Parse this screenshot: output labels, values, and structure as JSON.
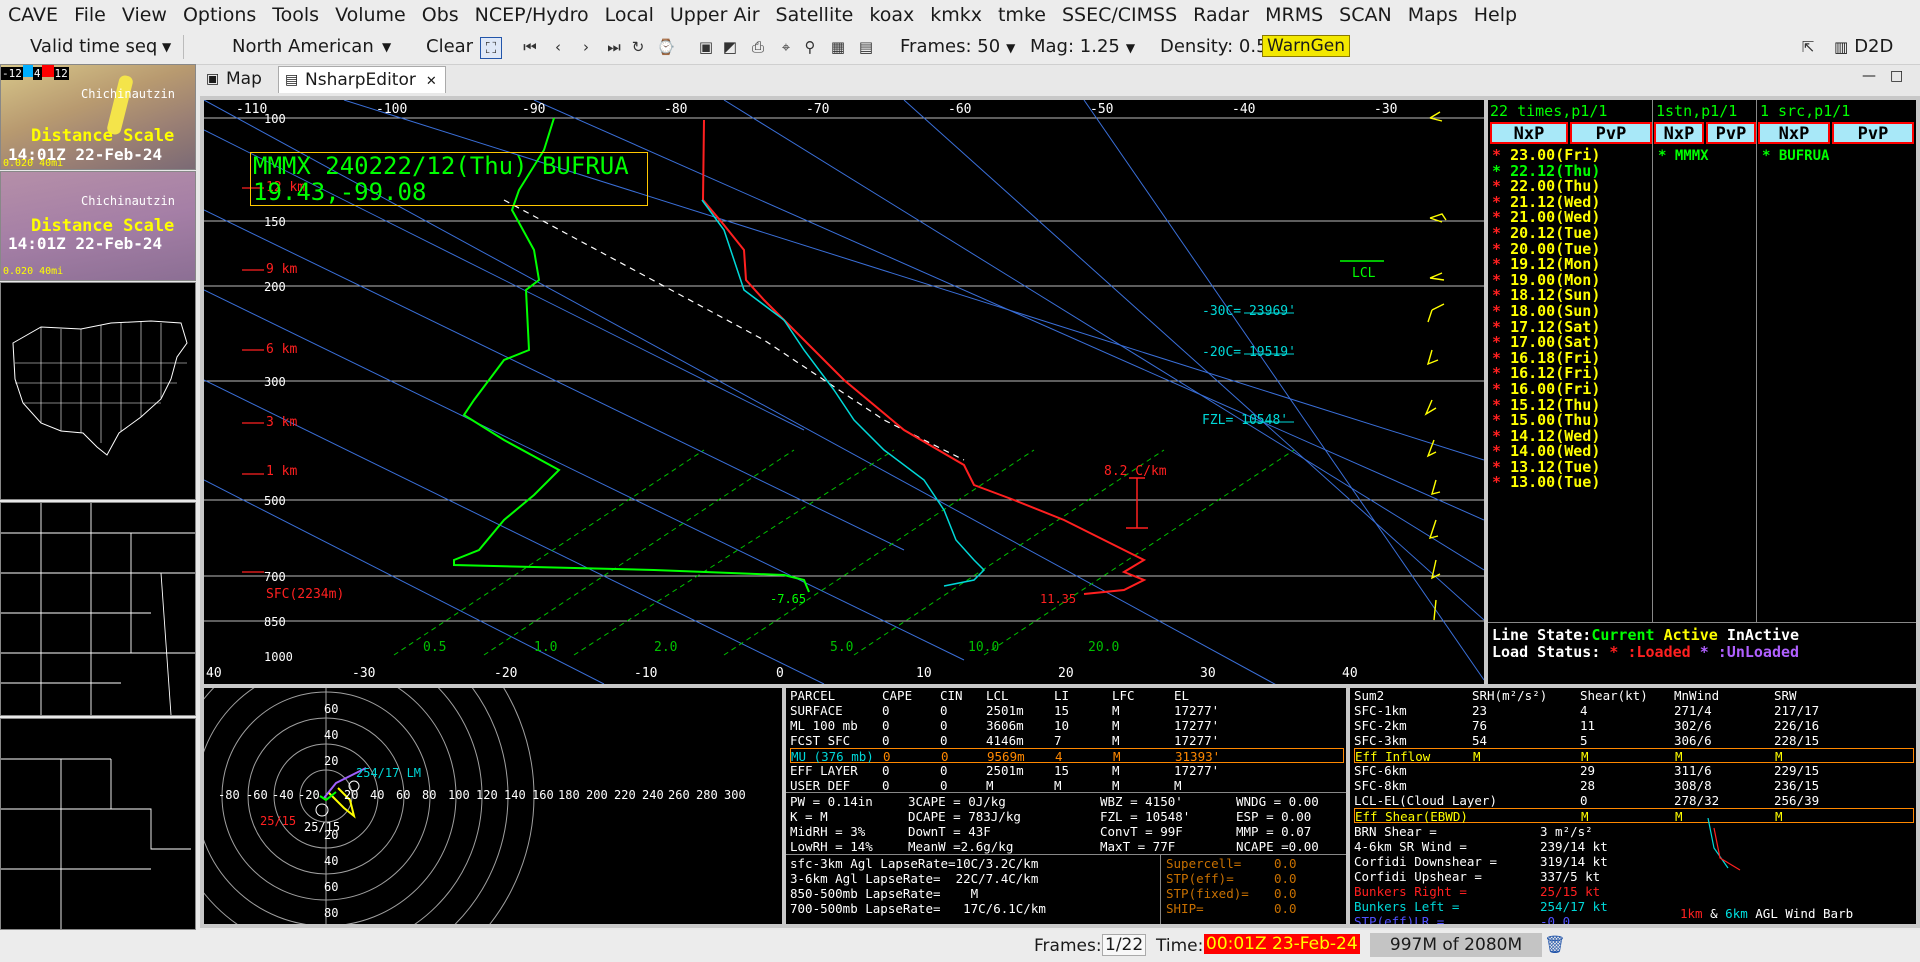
{
  "menu": [
    "CAVE",
    "File",
    "View",
    "Options",
    "Tools",
    "Volume",
    "Obs",
    "NCEP/Hydro",
    "Local",
    "Upper Air",
    "Satellite",
    "koax",
    "kmkx",
    "tmke",
    "SSEC/CIMSS",
    "Radar",
    "MRMS",
    "SCAN",
    "Maps",
    "Help"
  ],
  "toolbar": {
    "time_mode": "Valid time seq",
    "projection": "North American",
    "clear": "Clear",
    "frames": "Frames: 50",
    "mag": "Mag: 1.25",
    "density": "Density: 0.5",
    "warngen": "WarnGen",
    "d2d": "D2D"
  },
  "left_panels": {
    "colorbar": [
      "-12",
      "4",
      "12"
    ],
    "place": "Chichinautzin",
    "distance_scale": "Distance Scale",
    "time": "14:01Z 22-Feb-24",
    "scale_label": "0.020 40mi"
  },
  "tabs": {
    "map": "Map",
    "nsharp": "NsharpEditor"
  },
  "skewt": {
    "station_title": "MMMX 240222/12(Thu) BUFRUA",
    "latlon": "19.43,-99.08",
    "top_temps": [
      "-110",
      "-100",
      "-90",
      "-80",
      "-70",
      "-60",
      "-50",
      "-40",
      "-30"
    ],
    "bottom_temps": [
      "40",
      "-30",
      "-20",
      "-10",
      "0",
      "10",
      "20",
      "30",
      "40"
    ],
    "pressures": [
      "100",
      "150",
      "200",
      "300",
      "500",
      "700",
      "850",
      "1000"
    ],
    "heights": [
      "12 km",
      "9 km",
      "6 km",
      "3 km",
      "1 km",
      "SFC(2234m)"
    ],
    "mixing": [
      "0.5",
      "1.0",
      "2.0",
      "5.0",
      "10.0",
      "20.0"
    ],
    "lcl": "LCL",
    "m30c": "-30C=",
    "m30c_val": "23969'",
    "m20c": "-20C=",
    "m20c_val": "19519'",
    "fzl": "FZL=",
    "fzl_val": "10548'",
    "lapse": "8.2 C/km",
    "sfc_td": "-7.65",
    "sfc_t": "11.35"
  },
  "time_panel": {
    "header_times": "22 times,p1/1",
    "header_stn": "1stn,p1/1",
    "header_src": "1 src,p1/1",
    "col_labels": [
      "NxP",
      "PvP",
      "NxP",
      "PvP",
      "NxP",
      "PvP"
    ],
    "times": [
      "23.00(Fri)",
      "22.12(Thu)",
      "22.00(Thu)",
      "21.12(Wed)",
      "21.00(Wed)",
      "20.12(Tue)",
      "20.00(Tue)",
      "19.12(Mon)",
      "19.00(Mon)",
      "18.12(Sun)",
      "18.00(Sun)",
      "17.12(Sat)",
      "17.00(Sat)",
      "16.18(Fri)",
      "16.12(Fri)",
      "16.00(Fri)",
      "15.12(Thu)",
      "15.00(Thu)",
      "14.12(Wed)",
      "14.00(Wed)",
      "13.12(Tue)",
      "13.00(Tue)"
    ],
    "station": "MMMX",
    "source": "BUFRUA",
    "line_state_label": "Line State:",
    "current": "Current",
    "active": "Active",
    "inactive": "InActive",
    "load_status": "Load Status:",
    "loaded": ":Loaded",
    "unloaded": ":UnLoaded"
  },
  "hodograph": {
    "rings": [
      "60",
      "40",
      "20",
      "20",
      "40",
      "60",
      "80"
    ],
    "x_labels": [
      "-80",
      "-60",
      "-40",
      "-20",
      "20",
      "40",
      "60",
      "80",
      "100",
      "120",
      "140",
      "160",
      "180",
      "200",
      "220",
      "240",
      "260",
      "280",
      "300"
    ],
    "lm": "254/17 LM",
    "rm": "25/15",
    "mean": "25/15"
  },
  "parcel_table": {
    "header": [
      "PARCEL",
      "CAPE",
      "CIN",
      "LCL",
      "LI",
      "LFC",
      "EL"
    ],
    "rows": [
      [
        "SURFACE",
        "0",
        "0",
        "2501m",
        "15",
        "M",
        "17277'"
      ],
      [
        "ML 100 mb",
        "0",
        "0",
        "3606m",
        "10",
        "M",
        "17277'"
      ],
      [
        "FCST SFC",
        "0",
        "0",
        "4146m",
        "7",
        "M",
        "17277'"
      ],
      [
        "MU (376 mb)",
        "0",
        "0",
        "9569m",
        "4",
        "M",
        "31393'"
      ],
      [
        "EFF LAYER",
        "0",
        "0",
        "2501m",
        "15",
        "M",
        "17277'"
      ],
      [
        "USER DEF",
        "0",
        "0",
        "M",
        "M",
        "M",
        "M"
      ]
    ],
    "thermo": [
      [
        "PW = 0.14in",
        "3CAPE = 0J/kg",
        "WBZ = 4150'",
        "WNDG = 0.00"
      ],
      [
        "K = M",
        "DCAPE = 783J/kg",
        "FZL = 10548'",
        "ESP = 0.00"
      ],
      [
        "MidRH = 3%",
        "DownT = 43F",
        "ConvT = 99F",
        "MMP = 0.07"
      ],
      [
        "LowRH = 14%",
        "MeanW =2.6g/kg",
        "MaxT = 77F",
        "NCAPE =0.00"
      ]
    ],
    "lapse": [
      "sfc-3km Agl LapseRate=10C/3.2C/km",
      "3-6km Agl LapseRate=  22C/7.4C/km",
      "850-500mb LapseRate=    M",
      "700-500mb LapseRate=   17C/6.1C/km"
    ],
    "severe": [
      [
        "Supercell=",
        "0.0"
      ],
      [
        "STP(eff)=",
        "0.0"
      ],
      [
        "STP(fixed)=",
        "0.0"
      ],
      [
        "SHIP=",
        "0.0"
      ]
    ]
  },
  "kin_table": {
    "header": [
      "Sum2",
      "SRH(m²/s²)",
      "Shear(kt)",
      "MnWind",
      "SRW"
    ],
    "rows": [
      [
        "SFC-1km",
        "23",
        "4",
        "271/4",
        "217/17"
      ],
      [
        "SFC-2km",
        "76",
        "11",
        "302/6",
        "226/16"
      ],
      [
        "SFC-3km",
        "54",
        "5",
        "306/6",
        "228/15"
      ],
      [
        "Eff Inflow",
        "M",
        "M",
        "M",
        "M"
      ],
      [
        "SFC-6km",
        "",
        "29",
        "311/6",
        "229/15"
      ],
      [
        "SFC-8km",
        "",
        "28",
        "308/8",
        "236/15"
      ],
      [
        "LCL-EL(Cloud Layer)",
        "",
        "0",
        "278/32",
        "256/39"
      ],
      [
        "Eff Shear(EBWD)",
        "",
        "M",
        "M",
        "M"
      ]
    ],
    "misc": [
      [
        "BRN Shear =",
        "3 m²/s²"
      ],
      [
        "4-6km SR Wind =",
        "239/14 kt"
      ],
      [
        "Corfidi Downshear =",
        "319/14 kt"
      ],
      [
        "Corfidi Upshear =",
        "337/5 kt"
      ],
      [
        "Bunkers Right =",
        "25/15 kt"
      ],
      [
        "Bunkers Left =",
        "254/17 kt"
      ],
      [
        "STP(eff)LR =",
        "-0.0"
      ]
    ],
    "barb_caption_1": "1km",
    "barb_caption_2": "&",
    "barb_caption_3": "6km",
    "barb_caption_4": "AGL Wind Barb"
  },
  "status": {
    "frames_label": "Frames:",
    "frames_value": "1/22",
    "time_label": "Time:",
    "time_value": "00:01Z 23-Feb-24",
    "memory": "997M of 2080M"
  }
}
